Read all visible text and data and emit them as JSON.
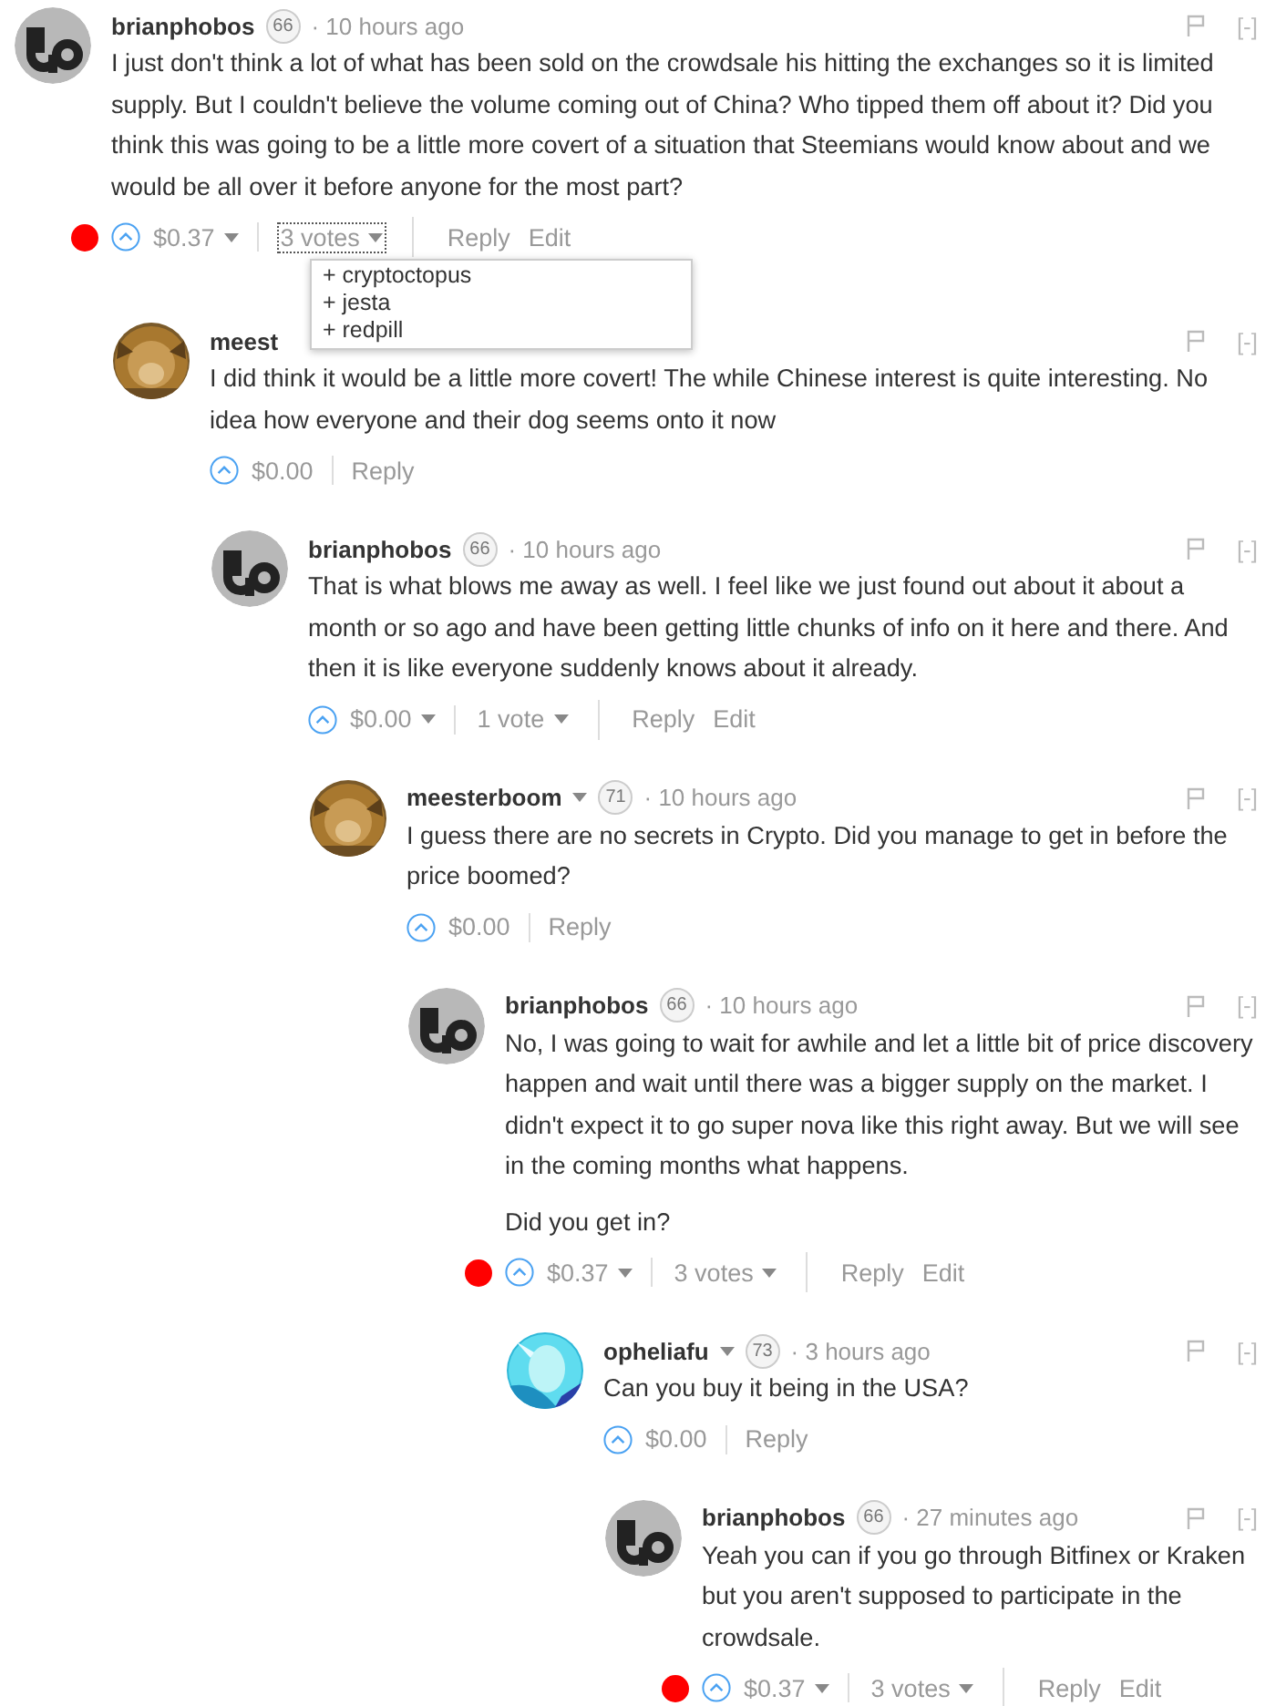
{
  "comments": [
    {
      "author": "brianphobos",
      "author_menu": false,
      "avatar": {
        "kind": "logo"
      },
      "reputation": "66",
      "time": "· 10 hours ago",
      "paragraphs": [
        "I just don't think a lot of what has been sold on the crowdsale his hitting the exchanges so it is limited supply. But I couldn't believe the volume coming out of China? Who tipped them off about it? Did you think this was going to be a little more covert of a situation that Steemians would know about and we would be all over it before anyone for the most part?"
      ],
      "collapse": "[-]",
      "highlighted": true,
      "payout": "$0.37",
      "payout_menu": true,
      "votes": {
        "label": "3 votes",
        "expanded": true,
        "voters": [
          "+ cryptoctopus",
          "+ jesta",
          "+ redpill"
        ]
      },
      "actions": [
        "Reply",
        "Edit"
      ],
      "children": [
        {
          "author": "meest",
          "author_menu": false,
          "avatar": {
            "kind": "picture"
          },
          "paragraphs": [
            "I did think it would be a little more covert! The while Chinese interest is quite interesting. No idea how everyone and their dog seems onto it now"
          ],
          "collapse": "[-]",
          "highlighted": false,
          "payout": "$0.00",
          "payout_menu": false,
          "actions": [
            "Reply"
          ],
          "children": [
            {
              "author": "brianphobos",
              "author_menu": false,
              "avatar": {
                "kind": "logo"
              },
              "reputation": "66",
              "time": "· 10 hours ago",
              "paragraphs": [
                "That is what blows me away as well. I feel like we just found out about it about a month or so ago and have been getting little chunks of info on it here and there. And then it is like everyone suddenly knows about it already."
              ],
              "collapse": "[-]",
              "highlighted": false,
              "payout": "$0.00",
              "payout_menu": true,
              "votes": {
                "label": "1 vote",
                "expanded": false
              },
              "actions": [
                "Reply",
                "Edit"
              ],
              "children": [
                {
                  "author": "meesterboom",
                  "author_menu": true,
                  "avatar": {
                    "kind": "picture"
                  },
                  "reputation": "71",
                  "time": "· 10 hours ago",
                  "paragraphs": [
                    "I guess there are no secrets in Crypto. Did you manage to get in before the price boomed?"
                  ],
                  "collapse": "[-]",
                  "highlighted": false,
                  "payout": "$0.00",
                  "payout_menu": false,
                  "actions": [
                    "Reply"
                  ],
                  "children": [
                    {
                      "author": "brianphobos",
                      "author_menu": false,
                      "avatar": {
                        "kind": "logo"
                      },
                      "reputation": "66",
                      "time": "· 10 hours ago",
                      "paragraphs": [
                        "No, I was going to wait for awhile and let a little bit of price discovery happen and wait until there was a bigger supply on the market. I didn't expect it to go super nova like this right away. But we will see in the coming months what happens.",
                        "Did you get in?"
                      ],
                      "collapse": "[-]",
                      "highlighted": true,
                      "payout": "$0.37",
                      "payout_menu": true,
                      "votes": {
                        "label": "3 votes",
                        "expanded": false
                      },
                      "actions": [
                        "Reply",
                        "Edit"
                      ],
                      "children": [
                        {
                          "author": "opheliafu",
                          "author_menu": true,
                          "avatar": {
                            "kind": "picture2"
                          },
                          "reputation": "73",
                          "time": "· 3 hours ago",
                          "paragraphs": [
                            "Can you buy it being in the USA?"
                          ],
                          "collapse": "[-]",
                          "highlighted": false,
                          "payout": "$0.00",
                          "payout_menu": false,
                          "actions": [
                            "Reply"
                          ],
                          "children": [
                            {
                              "author": "brianphobos",
                              "author_menu": false,
                              "avatar": {
                                "kind": "logo"
                              },
                              "reputation": "66",
                              "time": "· 27 minutes ago",
                              "paragraphs": [
                                "Yeah you can if you go through Bitfinex or Kraken but you aren't supposed to participate in the crowdsale."
                              ],
                              "collapse": "[-]",
                              "highlighted": true,
                              "payout": "$0.37",
                              "payout_menu": true,
                              "votes": {
                                "label": "3 votes",
                                "expanded": false
                              },
                              "actions": [
                                "Reply",
                                "Edit"
                              ]
                            }
                          ]
                        }
                      ]
                    }
                  ]
                }
              ]
            }
          ]
        }
      ]
    }
  ]
}
